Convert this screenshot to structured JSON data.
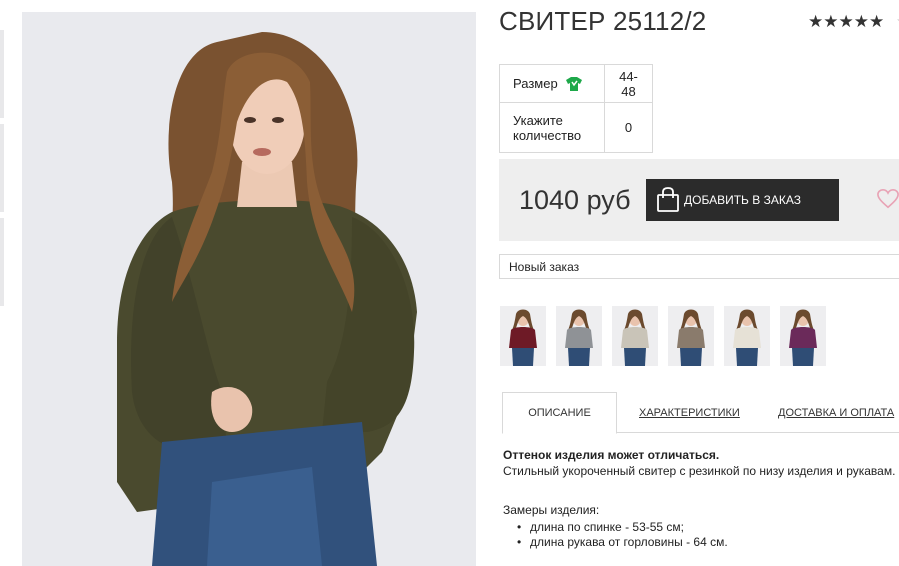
{
  "product": {
    "title": "СВИТЕР 25112/2",
    "rating_stars": "★★★★★",
    "rating_extra": "☆"
  },
  "options": {
    "size_label": "Размер",
    "size_value": "44-48",
    "qty_label": "Укажите количество",
    "qty_value": "0"
  },
  "buy": {
    "price": "1040 руб",
    "add_label": "ДОБАВИТЬ В ЗАКАЗ"
  },
  "order_select": {
    "selected": "Новый заказ"
  },
  "colors": {
    "accent_green": "#1ea84a",
    "button_dark": "#2b2b2b",
    "heart_pink": "#e8a3b5",
    "sweater_olive": "#4a4a2e"
  },
  "variants": [
    {
      "name": "burgundy",
      "color": "#6e1a26"
    },
    {
      "name": "grey",
      "color": "#8f9296"
    },
    {
      "name": "beige-light",
      "color": "#c9c4b8"
    },
    {
      "name": "mocha",
      "color": "#8a7b6c"
    },
    {
      "name": "cream",
      "color": "#e6e1d6"
    },
    {
      "name": "plum",
      "color": "#6b2a5a"
    }
  ],
  "tabs": [
    {
      "label": "ОПИСАНИЕ"
    },
    {
      "label": "ХАРАКТЕРИСТИКИ"
    },
    {
      "label": "ДОСТАВКА И ОПЛАТА"
    }
  ],
  "description": {
    "note": "Оттенок изделия может отличаться.",
    "text": "Стильный укороченный свитер с резинкой по низу изделия и рукавам.",
    "measures_title": "Замеры изделия:",
    "measures": [
      "длина по спинке - 53-55 см;",
      "длина рукава от горловины - 64 см."
    ]
  }
}
